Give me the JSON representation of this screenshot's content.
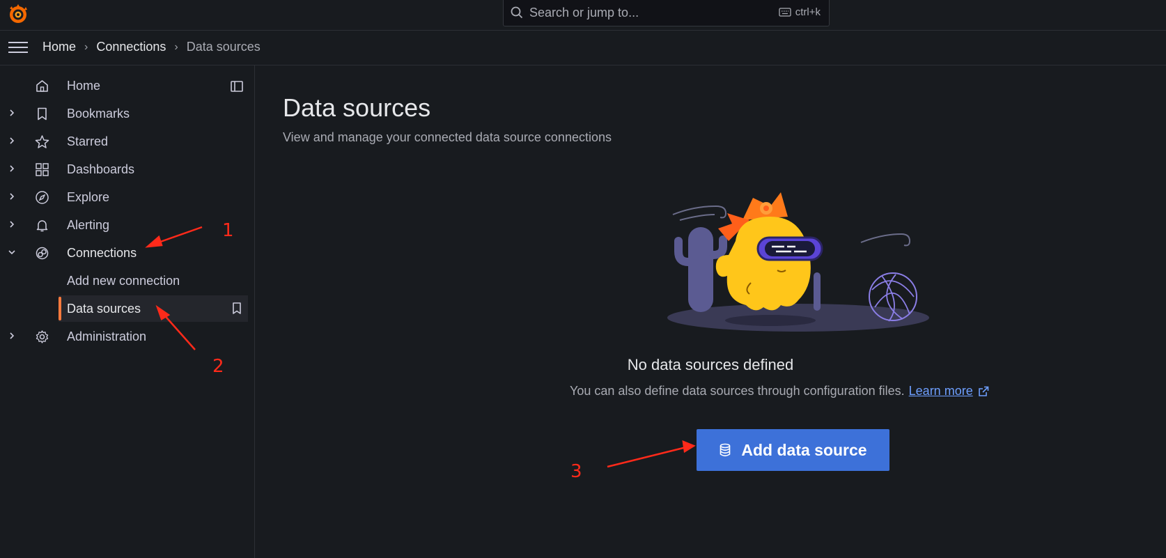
{
  "topbar": {
    "search_placeholder": "Search or jump to...",
    "shortcut": "ctrl+k"
  },
  "breadcrumb": [
    "Home",
    "Connections",
    "Data sources"
  ],
  "sidebar": {
    "items": [
      {
        "label": "Home",
        "icon": "home-icon"
      },
      {
        "label": "Bookmarks",
        "icon": "bookmark-icon"
      },
      {
        "label": "Starred",
        "icon": "star-icon"
      },
      {
        "label": "Dashboards",
        "icon": "apps-icon"
      },
      {
        "label": "Explore",
        "icon": "compass-icon"
      },
      {
        "label": "Alerting",
        "icon": "bell-icon"
      },
      {
        "label": "Connections",
        "icon": "connections-icon"
      },
      {
        "label": "Administration",
        "icon": "cog-icon"
      }
    ],
    "connections_children": [
      "Add new connection",
      "Data sources"
    ]
  },
  "main": {
    "title": "Data sources",
    "subtitle": "View and manage your connected data source connections",
    "empty_title": "No data sources defined",
    "empty_desc": "You can also define data sources through configuration files.",
    "learn_more": "Learn more",
    "add_button": "Add data source"
  },
  "annotations": [
    "1",
    "2",
    "3"
  ],
  "colors": {
    "background": "#181b1f",
    "accent_orange": "#ff7a3d",
    "primary_button": "#3d71d9",
    "link": "#6e9fff",
    "annotation_red": "#ff2a1a"
  }
}
